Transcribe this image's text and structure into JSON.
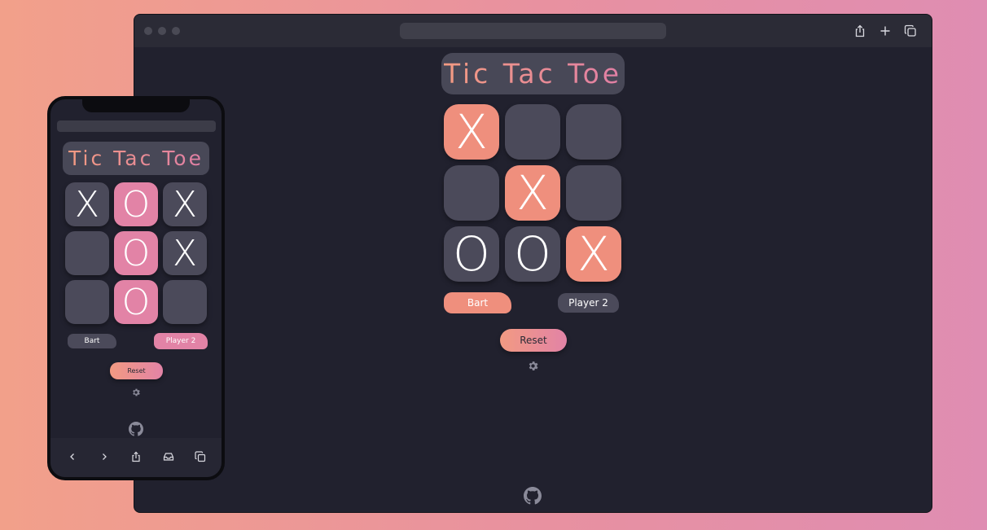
{
  "desktop": {
    "toolbar": {
      "share_icon": "share-icon",
      "new_tab_icon": "plus-icon",
      "tabs_icon": "tabs-icon"
    },
    "title": "Tic Tac Toe",
    "board": [
      "X",
      "",
      "",
      "",
      "X",
      "",
      "O",
      "O",
      "X"
    ],
    "highlight": [
      true,
      false,
      false,
      false,
      true,
      false,
      false,
      false,
      true
    ],
    "players": {
      "p1": "Bart",
      "p2": "Player 2",
      "active": "p1"
    },
    "reset_label": "Reset",
    "settings_icon": "gear-icon",
    "github_icon": "github-icon"
  },
  "mobile": {
    "title": "Tic Tac Toe",
    "board": [
      "X",
      "O",
      "X",
      "",
      "O",
      "X",
      "",
      "O",
      ""
    ],
    "highlight": [
      false,
      true,
      false,
      false,
      true,
      false,
      false,
      true,
      false
    ],
    "players": {
      "p1": "Bart",
      "p2": "Player 2",
      "active": "p2"
    },
    "reset_label": "Reset",
    "settings_icon": "gear-icon",
    "github_icon": "github-icon",
    "bottom_bar_icons": [
      "back-icon",
      "forward-icon",
      "share-icon",
      "inbox-icon",
      "tabs-icon"
    ]
  },
  "colors": {
    "background_start": "#f2a08a",
    "background_end": "#df8db2",
    "window": "#21212e",
    "cell": "#4b4a5a",
    "x_highlight": "#ef8f7d",
    "o_highlight": "#e283a6"
  }
}
